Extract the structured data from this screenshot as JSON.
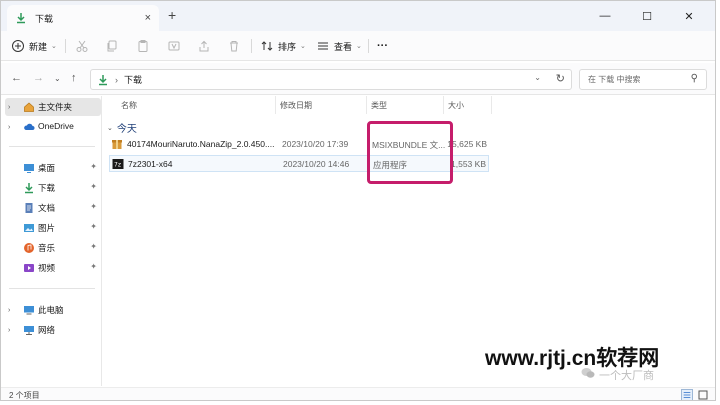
{
  "window": {
    "tab_title": "下载",
    "tab_close": "×",
    "new_tab": "+",
    "min": "—",
    "max": "☐",
    "close": "✕"
  },
  "toolbar": {
    "new_label": "新建",
    "sort_label": "排序",
    "view_label": "查看",
    "more_label": "···"
  },
  "address": {
    "separator": "›",
    "location": "下载",
    "search_placeholder": "在 下载 中搜索"
  },
  "sidebar": {
    "items": [
      {
        "label": "主文件夹"
      },
      {
        "label": "OneDrive"
      },
      {
        "label": "桌面"
      },
      {
        "label": "下载"
      },
      {
        "label": "文档"
      },
      {
        "label": "图片"
      },
      {
        "label": "音乐"
      },
      {
        "label": "视频"
      },
      {
        "label": "此电脑"
      },
      {
        "label": "网络"
      }
    ]
  },
  "columns": {
    "name": "名称",
    "date": "修改日期",
    "type": "类型",
    "size": "大小"
  },
  "group": {
    "label": "今天"
  },
  "files": [
    {
      "name": "40174MouriNaruto.NanaZip_2.0.450....",
      "date": "2023/10/20 17:39",
      "type": "MSIXBUNDLE 文...",
      "size": "15,625 KB"
    },
    {
      "name": "7z2301-x64",
      "date": "2023/10/20 14:46",
      "type": "应用程序",
      "size": "1,553 KB"
    }
  ],
  "status": {
    "count": "2 个项目"
  },
  "watermark": {
    "site": "www.rjtj.cn软荐网",
    "account": "一个大厂商"
  },
  "colors": {
    "highlight": "#c51d6b",
    "folder_download": "#2e9a5a",
    "accent_blue": "#2a6fc9"
  }
}
